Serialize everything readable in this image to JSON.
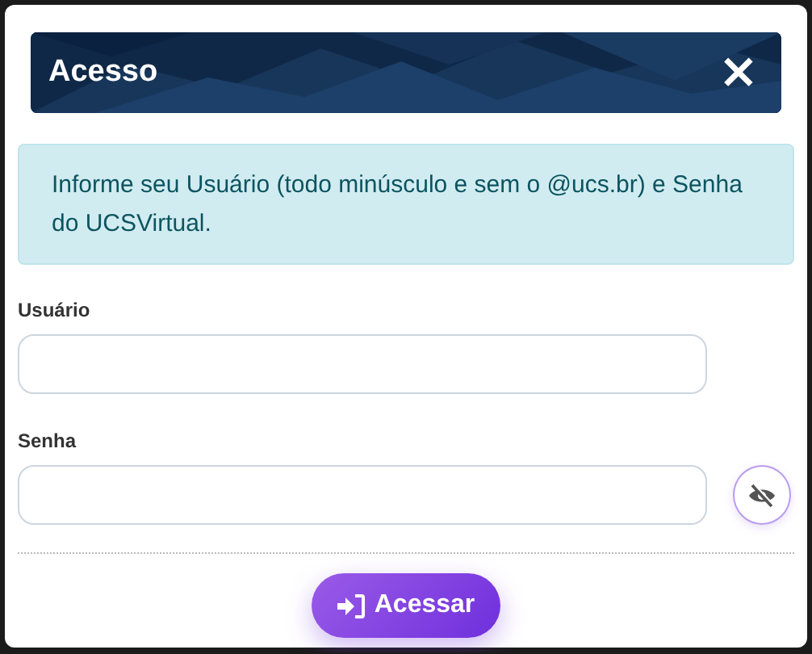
{
  "dialog": {
    "title": "Acesso",
    "close": "×"
  },
  "alert": {
    "text": "Informe seu Usuário (todo minúsculo e sem o @ucs.br) e Senha do UCSVirtual."
  },
  "fields": [
    {
      "label": "Usuário",
      "kind": "text"
    },
    {
      "label": "Senha",
      "kind": "password",
      "reveal": false
    }
  ],
  "submit": {
    "label": "Acessar"
  }
}
